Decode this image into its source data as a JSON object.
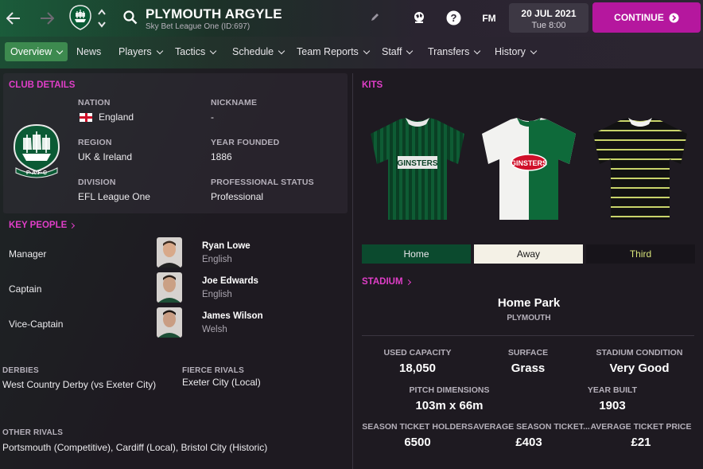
{
  "header": {
    "club_name": "PLYMOUTH ARGYLE",
    "competition": "Sky Bet League One (ID:697)",
    "fm_label": "FM",
    "date": "20 JUL 2021",
    "day_time": "Tue 8:00",
    "continue_label": "CONTINUE"
  },
  "nav": {
    "items": [
      {
        "label": "Overview"
      },
      {
        "label": "News"
      },
      {
        "label": "Players"
      },
      {
        "label": "Tactics"
      },
      {
        "label": "Schedule"
      },
      {
        "label": "Team Reports"
      },
      {
        "label": "Staff"
      },
      {
        "label": "Transfers"
      },
      {
        "label": "History"
      }
    ]
  },
  "club_details": {
    "heading": "CLUB DETAILS",
    "crest_text": "P·A·F·C",
    "nation_label": "NATION",
    "nation_value": "England",
    "nickname_label": "NICKNAME",
    "nickname_value": "-",
    "region_label": "REGION",
    "region_value": "UK & Ireland",
    "year_founded_label": "YEAR FOUNDED",
    "year_founded_value": "1886",
    "division_label": "DIVISION",
    "division_value": "EFL League One",
    "status_label": "PROFESSIONAL STATUS",
    "status_value": "Professional"
  },
  "key_people": {
    "heading": "KEY PEOPLE",
    "people": [
      {
        "role": "Manager",
        "name": "Ryan Lowe",
        "nationality": "English"
      },
      {
        "role": "Captain",
        "name": "Joe Edwards",
        "nationality": "English"
      },
      {
        "role": "Vice-Captain",
        "name": "James Wilson",
        "nationality": "Welsh"
      }
    ]
  },
  "rivals": {
    "derbies_label": "DERBIES",
    "derbies_value": "West Country Derby (vs Exeter City)",
    "fierce_label": "FIERCE RIVALS",
    "fierce_value": "Exeter City (Local)",
    "other_label": "OTHER RIVALS",
    "other_value": "Portsmouth (Competitive), Cardiff (Local), Bristol City (Historic)"
  },
  "kits": {
    "heading": "KITS",
    "sponsor": "GINSTERS",
    "tabs": [
      {
        "label": "Home",
        "bg": "#0b4a2e",
        "color": "#e8e6ea"
      },
      {
        "label": "Away",
        "bg": "#f4f1e6",
        "color": "#1a1a1a"
      },
      {
        "label": "Third",
        "bg": "#17141a",
        "color": "#d8e47a"
      }
    ]
  },
  "stadium": {
    "heading": "STADIUM",
    "name": "Home Park",
    "city": "PLYMOUTH",
    "used_capacity_label": "USED CAPACITY",
    "used_capacity_value": "18,050",
    "surface_label": "SURFACE",
    "surface_value": "Grass",
    "condition_label": "STADIUM CONDITION",
    "condition_value": "Very Good",
    "pitch_label": "PITCH DIMENSIONS",
    "pitch_value": "103m x 66m",
    "year_built_label": "YEAR BUILT",
    "year_built_value": "1903",
    "season_holders_label": "SEASON TICKET HOLDERS",
    "season_holders_value": "6500",
    "avg_season_label": "AVERAGE SEASON TICKET...",
    "avg_season_value": "£403",
    "avg_ticket_label": "AVERAGE TICKET PRICE",
    "avg_ticket_value": "£21"
  },
  "colors": {
    "accent": "#e03ec8",
    "continue_button": "#b5179e",
    "active_tab": "#3d8a4f",
    "club_green": "#0b5a35"
  }
}
